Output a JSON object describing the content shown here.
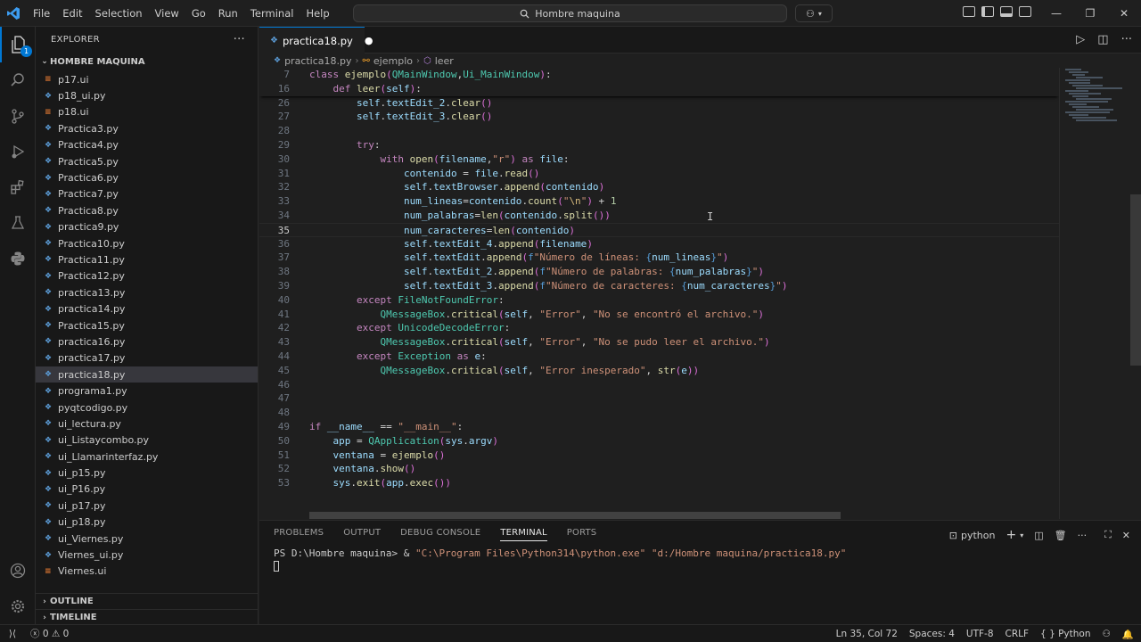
{
  "titlebar": {
    "menu": [
      "File",
      "Edit",
      "Selection",
      "View",
      "Go",
      "Run",
      "Terminal",
      "Help"
    ],
    "search_text": "Hombre maquina"
  },
  "activity": {
    "explorer_badge": "1"
  },
  "sidebar": {
    "title": "EXPLORER",
    "folder": "HOMBRE MAQUINA",
    "files": [
      {
        "name": "p17.ui",
        "type": "ui"
      },
      {
        "name": "p18_ui.py",
        "type": "py"
      },
      {
        "name": "p18.ui",
        "type": "ui"
      },
      {
        "name": "Practica3.py",
        "type": "py"
      },
      {
        "name": "Practica4.py",
        "type": "py"
      },
      {
        "name": "Practica5.py",
        "type": "py"
      },
      {
        "name": "Practica6.py",
        "type": "py"
      },
      {
        "name": "Practica7.py",
        "type": "py"
      },
      {
        "name": "Practica8.py",
        "type": "py"
      },
      {
        "name": "practica9.py",
        "type": "py"
      },
      {
        "name": "Practica10.py",
        "type": "py"
      },
      {
        "name": "Practica11.py",
        "type": "py"
      },
      {
        "name": "Practica12.py",
        "type": "py"
      },
      {
        "name": "practica13.py",
        "type": "py"
      },
      {
        "name": "practica14.py",
        "type": "py"
      },
      {
        "name": "Practica15.py",
        "type": "py"
      },
      {
        "name": "practica16.py",
        "type": "py"
      },
      {
        "name": "practica17.py",
        "type": "py"
      },
      {
        "name": "practica18.py",
        "type": "py",
        "selected": true
      },
      {
        "name": "programa1.py",
        "type": "py"
      },
      {
        "name": "pyqtcodigo.py",
        "type": "py"
      },
      {
        "name": "ui_lectura.py",
        "type": "py"
      },
      {
        "name": "ui_Listaycombo.py",
        "type": "py"
      },
      {
        "name": "ui_Llamarinterfaz.py",
        "type": "py"
      },
      {
        "name": "ui_p15.py",
        "type": "py"
      },
      {
        "name": "ui_P16.py",
        "type": "py"
      },
      {
        "name": "ui_p17.py",
        "type": "py"
      },
      {
        "name": "ui_p18.py",
        "type": "py"
      },
      {
        "name": "ui_Viernes.py",
        "type": "py"
      },
      {
        "name": "Viernes_ui.py",
        "type": "py"
      },
      {
        "name": "Viernes.ui",
        "type": "ui"
      }
    ],
    "outline": "OUTLINE",
    "timeline": "TIMELINE"
  },
  "editor": {
    "tab_label": "practica18.py",
    "breadcrumbs": [
      "practica18.py",
      "ejemplo",
      "leer"
    ],
    "current_line": 35,
    "lines": [
      {
        "n": 7,
        "code": "class ejemplo(QMainWindow,Ui_MainWindow):"
      },
      {
        "n": 16,
        "code": "    def leer(self):"
      },
      {
        "n": 26,
        "code": "        self.textEdit_2.clear()"
      },
      {
        "n": 27,
        "code": "        self.textEdit_3.clear()"
      },
      {
        "n": 28,
        "code": ""
      },
      {
        "n": 29,
        "code": "        try:"
      },
      {
        "n": 30,
        "code": "            with open(filename,\"r\") as file:"
      },
      {
        "n": 31,
        "code": "                contenido = file.read()"
      },
      {
        "n": 32,
        "code": "                self.textBrowser.append(contenido)"
      },
      {
        "n": 33,
        "code": "                num_lineas=contenido.count(\"\\n\") + 1"
      },
      {
        "n": 34,
        "code": "                num_palabras=len(contenido.split())"
      },
      {
        "n": 35,
        "code": "                num_caracteres=len(contenido)"
      },
      {
        "n": 36,
        "code": "                self.textEdit_4.append(filename)"
      },
      {
        "n": 37,
        "code": "                self.textEdit.append(f\"Número de líneas: {num_lineas}\")"
      },
      {
        "n": 38,
        "code": "                self.textEdit_2.append(f\"Número de palabras: {num_palabras}\")"
      },
      {
        "n": 39,
        "code": "                self.textEdit_3.append(f\"Número de caracteres: {num_caracteres}\")"
      },
      {
        "n": 40,
        "code": "        except FileNotFoundError:"
      },
      {
        "n": 41,
        "code": "            QMessageBox.critical(self, \"Error\", \"No se encontró el archivo.\")"
      },
      {
        "n": 42,
        "code": "        except UnicodeDecodeError:"
      },
      {
        "n": 43,
        "code": "            QMessageBox.critical(self, \"Error\", \"No se pudo leer el archivo.\")"
      },
      {
        "n": 44,
        "code": "        except Exception as e:"
      },
      {
        "n": 45,
        "code": "            QMessageBox.critical(self, \"Error inesperado\", str(e))"
      },
      {
        "n": 46,
        "code": ""
      },
      {
        "n": 47,
        "code": ""
      },
      {
        "n": 48,
        "code": ""
      },
      {
        "n": 49,
        "code": "if __name__ == \"__main__\":"
      },
      {
        "n": 50,
        "code": "    app = QApplication(sys.argv)"
      },
      {
        "n": 51,
        "code": "    ventana = ejemplo()"
      },
      {
        "n": 52,
        "code": "    ventana.show()"
      },
      {
        "n": 53,
        "code": "    sys.exit(app.exec())"
      }
    ]
  },
  "panel": {
    "tabs": [
      "PROBLEMS",
      "OUTPUT",
      "DEBUG CONSOLE",
      "TERMINAL",
      "PORTS"
    ],
    "active_tab": "TERMINAL",
    "terminal_profile": "python",
    "prompt": "PS D:\\Hombre maquina> & ",
    "cmd_exe": "\"C:\\Program Files\\Python314\\python.exe\"",
    "cmd_arg": " \"d:/Hombre maquina/practica18.py\""
  },
  "statusbar": {
    "errors": "0",
    "warnings": "0",
    "position": "Ln 35, Col 72",
    "spaces": "Spaces: 4",
    "encoding": "UTF-8",
    "eol": "CRLF",
    "language": "Python"
  }
}
